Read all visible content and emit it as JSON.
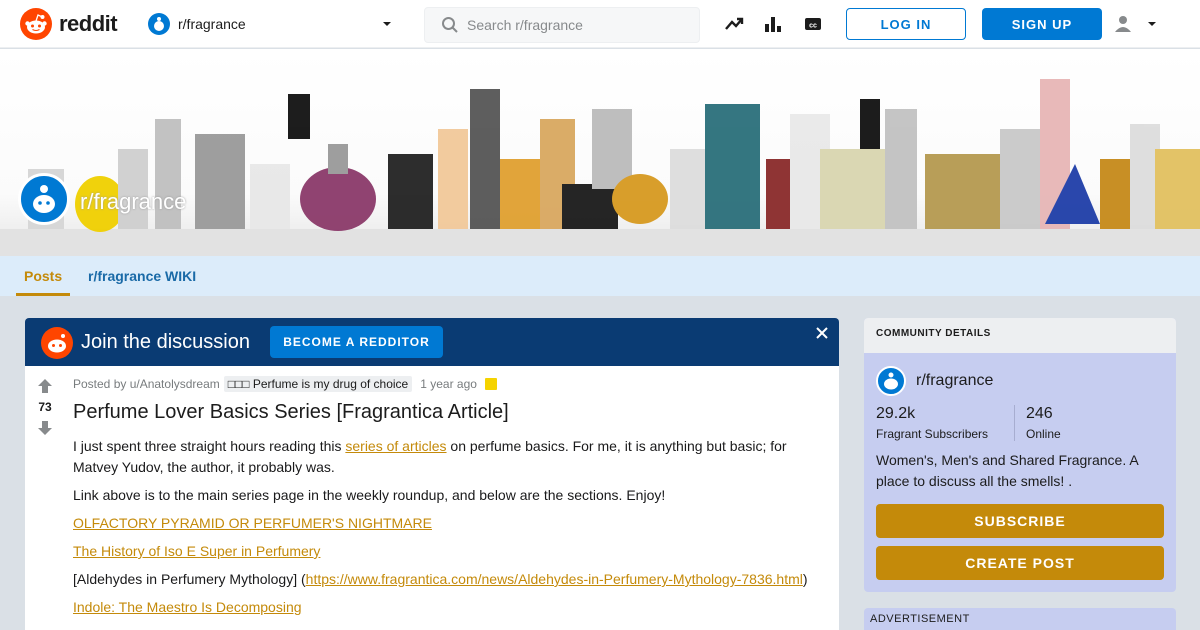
{
  "header": {
    "logo_text": "reddit",
    "subreddit": "r/fragrance",
    "search_placeholder": "Search r/fragrance",
    "login_label": "LOG IN",
    "signup_label": "SIGN UP",
    "icons": [
      "trending-icon",
      "stats-icon",
      "closed-caption-icon",
      "user-icon",
      "chevron-down-icon"
    ]
  },
  "banner": {
    "title": "r/fragrance"
  },
  "tabs": [
    {
      "label": "Posts"
    },
    {
      "label": "r/fragrance WIKI"
    }
  ],
  "join": {
    "text": "Join the discussion",
    "button": "BECOME A REDDITOR"
  },
  "post": {
    "votes": "73",
    "posted_by": "Posted by u/Anatolysdream",
    "flair": "□□□ Perfume is my drug of choice",
    "ago": "1 year ago",
    "title": "Perfume Lover Basics Series [Fragrantica Article]",
    "p1_before": "I just spent three straight hours reading this ",
    "p1_link": "series of articles",
    "p1_after": " on perfume basics. For me, it is anything but basic; for Matvey Yudov, the author, it probably was.",
    "p2": "Link above is to the main series page in the weekly roundup, and below are the sections. Enjoy!",
    "link1": "OLFACTORY PYRAMID OR PERFUMER'S NIGHTMARE",
    "link2": "The History of Iso E Super in Perfumery",
    "p5_before": "[Aldehydes in Perfumery Mythology] (",
    "p5_link": "https://www.fragrantica.com/news/Aldehydes-in-Perfumery-Mythology-7836.html",
    "p5_after": ")",
    "link3": "Indole: The Maestro Is Decomposing"
  },
  "sidebar": {
    "heading": "COMMUNITY DETAILS",
    "name": "r/fragrance",
    "subscribers": "29.2k",
    "subscribers_label": "Fragrant Subscribers",
    "online": "246",
    "online_label": "Online",
    "description": "Women's, Men's and Shared Fragrance. A place to discuss all the smells! .",
    "subscribe": "SUBSCRIBE",
    "create_post": "CREATE POST",
    "advertisement": "ADVERTISEMENT"
  },
  "colors": {
    "reddit_orange": "#ff4500",
    "blue": "#0079d3",
    "gold": "#c48a0a",
    "join_bg": "#0a3b73",
    "sidebar_bg": "#c6cdf0"
  }
}
